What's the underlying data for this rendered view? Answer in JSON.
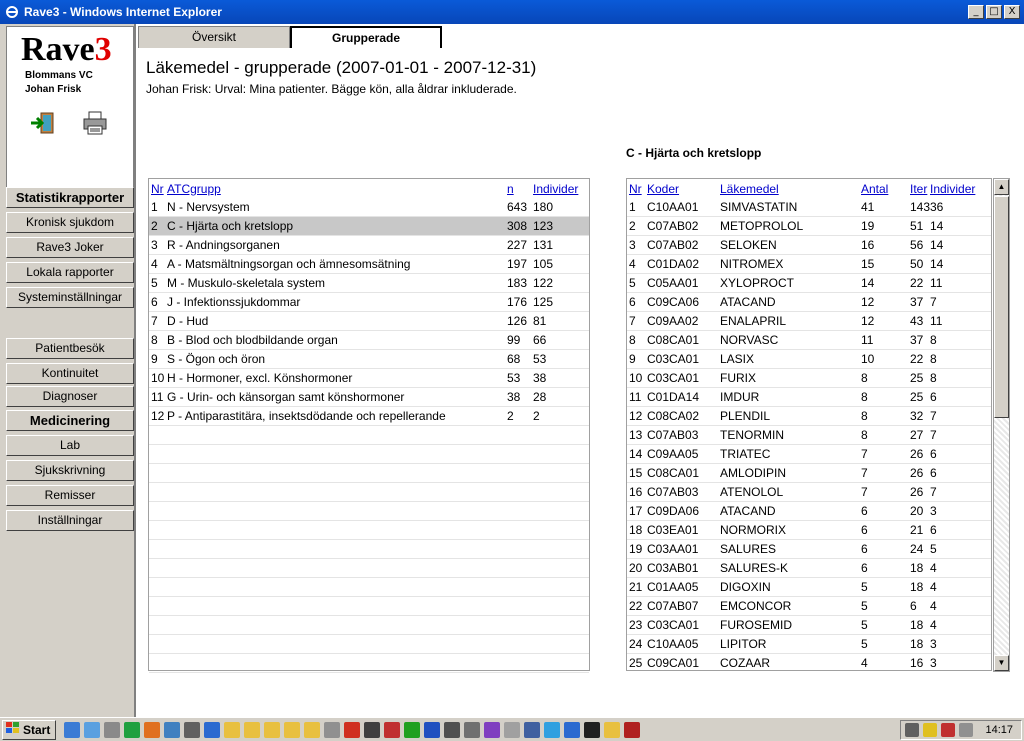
{
  "window": {
    "title": "Rave3 - Windows Internet Explorer",
    "min": "_",
    "max": "□",
    "close": "X"
  },
  "sidebar": {
    "logo_text": "Rave",
    "logo_num": "3",
    "practice": "Blommans VC",
    "doctor": "Johan Frisk",
    "items": [
      {
        "label": "Statistikrapporter",
        "bold": true
      },
      {
        "label": "Kronisk sjukdom"
      },
      {
        "label": "Rave3 Joker"
      },
      {
        "label": "Lokala rapporter"
      },
      {
        "label": "Systeminställningar"
      },
      {
        "label": "Patientbesök"
      },
      {
        "label": "Kontinuitet"
      },
      {
        "label": "Diagnoser"
      },
      {
        "label": "Medicinering",
        "bold": true
      },
      {
        "label": "Lab"
      },
      {
        "label": "Sjukskrivning"
      },
      {
        "label": "Remisser"
      },
      {
        "label": "Inställningar"
      }
    ]
  },
  "tabs": [
    {
      "label": "Översikt"
    },
    {
      "label": "Grupperade",
      "active": true
    }
  ],
  "main": {
    "title": "Läkemedel - grupperade (2007-01-01 - 2007-12-31)",
    "subtitle": "Johan Frisk: Urval: Mina patienter. Bägge kön, alla åldrar inkluderade.",
    "detail_heading": "C - Hjärta och kretslopp"
  },
  "left_table": {
    "headers": [
      "Nr",
      "ATCgrupp",
      "n",
      "Individer"
    ],
    "rows": [
      [
        "1",
        "N - Nervsystem",
        "643",
        "180"
      ],
      [
        "2",
        "C - Hjärta och kretslopp",
        "308",
        "123"
      ],
      [
        "3",
        "R - Andningsorganen",
        "227",
        "131"
      ],
      [
        "4",
        "A - Matsmältningsorgan och ämnesomsätning",
        "197",
        "105"
      ],
      [
        "5",
        "M - Muskulo-skeletala system",
        "183",
        "122"
      ],
      [
        "6",
        "J - Infektionssjukdommar",
        "176",
        "125"
      ],
      [
        "7",
        "D - Hud",
        "126",
        "81"
      ],
      [
        "8",
        "B - Blod och blodbildande organ",
        "99",
        "66"
      ],
      [
        "9",
        "S - Ögon och öron",
        "68",
        "53"
      ],
      [
        "10",
        "H - Hormoner, excl. Könshormoner",
        "53",
        "38"
      ],
      [
        "11",
        "G - Urin- och känsorgan samt könshormoner",
        "38",
        "28"
      ],
      [
        "12",
        "P - Antiparastitära, insektsdödande och repellerande",
        "2",
        "2"
      ]
    ],
    "selected_index": 1
  },
  "right_table": {
    "headers": [
      "Nr",
      "Koder",
      "Läkemedel",
      "Antal",
      "Iter",
      "Individer"
    ],
    "rows": [
      [
        "1",
        "C10AA01",
        "SIMVASTATIN",
        "41",
        "143",
        "36"
      ],
      [
        "2",
        "C07AB02",
        "METOPROLOL",
        "19",
        "51",
        "14"
      ],
      [
        "3",
        "C07AB02",
        "SELOKEN",
        "16",
        "56",
        "14"
      ],
      [
        "4",
        "C01DA02",
        "NITROMEX",
        "15",
        "50",
        "14"
      ],
      [
        "5",
        "C05AA01",
        "XYLOPROCT",
        "14",
        "22",
        "11"
      ],
      [
        "6",
        "C09CA06",
        "ATACAND",
        "12",
        "37",
        "7"
      ],
      [
        "7",
        "C09AA02",
        "ENALAPRIL",
        "12",
        "43",
        "11"
      ],
      [
        "8",
        "C08CA01",
        "NORVASC",
        "11",
        "37",
        "8"
      ],
      [
        "9",
        "C03CA01",
        "LASIX",
        "10",
        "22",
        "8"
      ],
      [
        "10",
        "C03CA01",
        "FURIX",
        "8",
        "25",
        "8"
      ],
      [
        "11",
        "C01DA14",
        "IMDUR",
        "8",
        "25",
        "6"
      ],
      [
        "12",
        "C08CA02",
        "PLENDIL",
        "8",
        "32",
        "7"
      ],
      [
        "13",
        "C07AB03",
        "TENORMIN",
        "8",
        "27",
        "7"
      ],
      [
        "14",
        "C09AA05",
        "TRIATEC",
        "7",
        "26",
        "6"
      ],
      [
        "15",
        "C08CA01",
        "AMLODIPIN",
        "7",
        "26",
        "6"
      ],
      [
        "16",
        "C07AB03",
        "ATENOLOL",
        "7",
        "26",
        "7"
      ],
      [
        "17",
        "C09DA06",
        "ATACAND",
        "6",
        "20",
        "3"
      ],
      [
        "18",
        "C03EA01",
        "NORMORIX",
        "6",
        "21",
        "6"
      ],
      [
        "19",
        "C03AA01",
        "SALURES",
        "6",
        "24",
        "5"
      ],
      [
        "20",
        "C03AB01",
        "SALURES-K",
        "6",
        "18",
        "4"
      ],
      [
        "21",
        "C01AA05",
        "DIGOXIN",
        "5",
        "18",
        "4"
      ],
      [
        "22",
        "C07AB07",
        "EMCONCOR",
        "5",
        "6",
        "4"
      ],
      [
        "23",
        "C03CA01",
        "FUROSEMID",
        "5",
        "18",
        "4"
      ],
      [
        "24",
        "C10AA05",
        "LIPITOR",
        "5",
        "18",
        "3"
      ],
      [
        "25",
        "C09CA01",
        "COZAAR",
        "4",
        "16",
        "3"
      ]
    ]
  },
  "taskbar": {
    "start_label": "Start",
    "clock": "14:17"
  },
  "colors": {
    "titlebar": "#0a5ad8",
    "link": "#0000cc",
    "selected_row": "#c8c8c8",
    "logo_accent": "#e00000"
  }
}
